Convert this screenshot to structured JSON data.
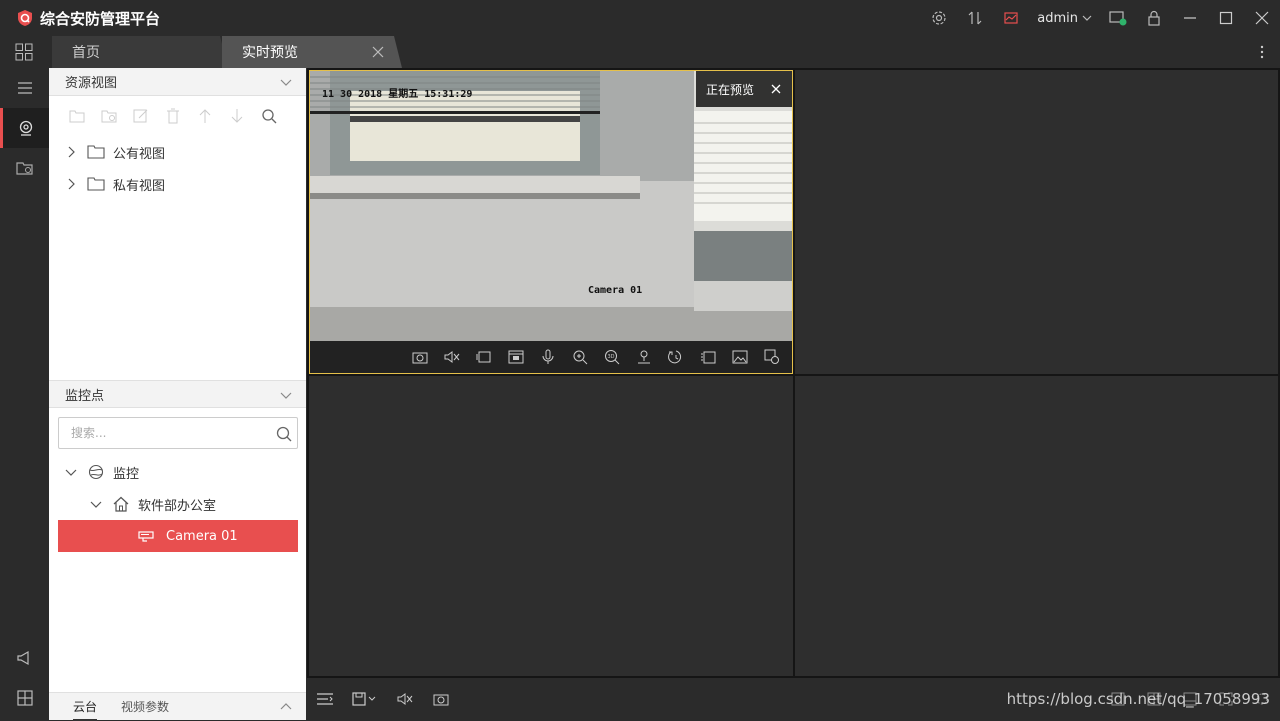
{
  "app": {
    "title": "综合安防管理平台",
    "brand_color": "#e84f4f"
  },
  "titlebar": {
    "user": "admin"
  },
  "tabs": [
    {
      "label": "首页",
      "active": false
    },
    {
      "label": "实时预览",
      "active": true
    }
  ],
  "resource_view": {
    "title": "资源视图",
    "toolbar_icons": [
      "add-folder-icon",
      "add-resource-icon",
      "edit-icon",
      "delete-icon",
      "move-up-icon",
      "move-down-icon",
      "search-icon"
    ],
    "items": [
      {
        "label": "公有视图",
        "icon": "folder-icon"
      },
      {
        "label": "私有视图",
        "icon": "folder-icon"
      }
    ]
  },
  "monitor_points": {
    "title": "监控点",
    "search_placeholder": "搜索...",
    "tree": [
      {
        "label": "监控",
        "icon": "globe-icon",
        "level": 0,
        "expanded": true
      },
      {
        "label": "软件部办公室",
        "icon": "home-icon",
        "level": 1,
        "expanded": true
      },
      {
        "label": "Camera 01",
        "icon": "camera-icon",
        "level": 2,
        "selected": true
      }
    ]
  },
  "bottom_tabs": [
    {
      "label": "云台",
      "active": true
    },
    {
      "label": "视频参数",
      "active": false
    }
  ],
  "preview": {
    "status": "正在预览",
    "osd_timestamp": "11 30 2018 星期五 15:31:29",
    "osd_camera": "Camera 01",
    "video_toolbar": [
      "snapshot-icon",
      "mute-icon",
      "window-icon",
      "record-icon",
      "microphone-icon",
      "zoom-in-icon",
      "3d-zoom-icon",
      "ptz-icon",
      "playback-icon",
      "stream-icon",
      "image-icon",
      "more-settings-icon"
    ]
  },
  "watermark": "https://blog.csdn.net/qq_17058993"
}
